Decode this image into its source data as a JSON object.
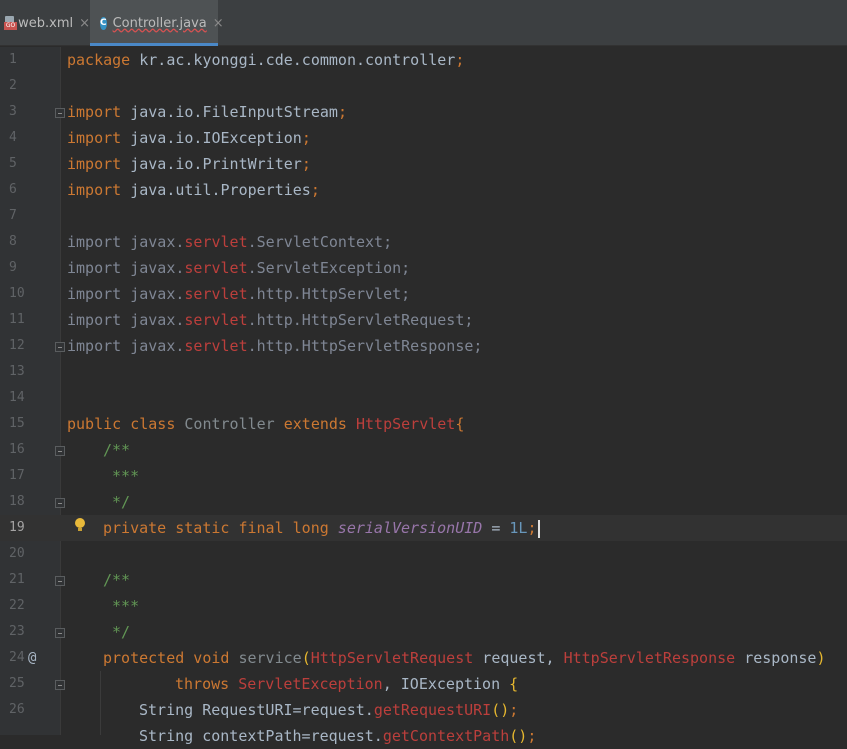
{
  "tabs": [
    {
      "label": "web.xml",
      "icon": "xml-file-icon",
      "close": "×",
      "badge": "GO"
    },
    {
      "label": "Controller.java",
      "icon": "java-class-icon",
      "icon_letter": "C",
      "close": "×"
    }
  ],
  "gutter": {
    "line_numbers": [
      "1",
      "2",
      "3",
      "4",
      "5",
      "6",
      "7",
      "8",
      "9",
      "10",
      "11",
      "12",
      "13",
      "14",
      "15",
      "16",
      "17",
      "18",
      "19",
      "20",
      "21",
      "22",
      "23",
      "24",
      "25",
      "26"
    ],
    "active_line": "19",
    "override_marker": "@"
  },
  "code": {
    "l1": {
      "kw": "package",
      "text": " kr.ac.kyonggi.cde.common.controller",
      "semi": ";"
    },
    "l3": {
      "kw": "import",
      "text": " java.io.FileInputStream",
      "semi": ";"
    },
    "l4": {
      "kw": "import",
      "text": " java.io.IOException",
      "semi": ";"
    },
    "l5": {
      "kw": "import",
      "text": " java.io.PrintWriter",
      "semi": ";"
    },
    "l6": {
      "kw": "import",
      "text": " java.util.Properties",
      "semi": ";"
    },
    "l8": {
      "a": "import javax.",
      "b": "servlet",
      "c": ".ServletContext;"
    },
    "l9": {
      "a": "import javax.",
      "b": "servlet",
      "c": ".ServletException;"
    },
    "l10": {
      "a": "import javax.",
      "b": "servlet",
      "c": ".http.HttpServlet;"
    },
    "l11": {
      "a": "import javax.",
      "b": "servlet",
      "c": ".http.HttpServletRequest;"
    },
    "l12": {
      "a": "import javax.",
      "b": "servlet",
      "c": ".http.HttpServletResponse;"
    },
    "l15": {
      "kw": "public class",
      "name": " Controller",
      "kw2": " extends",
      "sup": " HttpServlet",
      "brace": "{"
    },
    "l16": "/**",
    "l17": " ***",
    "l18": " */",
    "l19": {
      "kw": "private static final long",
      "field": " serialVersionUID",
      "eq": " = ",
      "num": "1L",
      "semi": ";"
    },
    "l21": "/**",
    "l22": " ***",
    "l23": " */",
    "l24": {
      "kw": "protected void",
      "method": " service",
      "p1": "(",
      "t1": "HttpServletRequest",
      "a1": " request, ",
      "t2": "HttpServletResponse",
      "a2": " response",
      "p2": ")"
    },
    "l25": {
      "kw": "throws",
      "t1": " ServletException",
      "rest": ", IOException ",
      "brace": "{"
    },
    "l26": {
      "a": "String RequestURI=request.",
      "m": "getRequestURI",
      "p": "()",
      "semi": ";"
    },
    "l27": {
      "a": "String contextPath=request.",
      "m": "getContextPath",
      "p": "()",
      "semi": ";"
    }
  }
}
